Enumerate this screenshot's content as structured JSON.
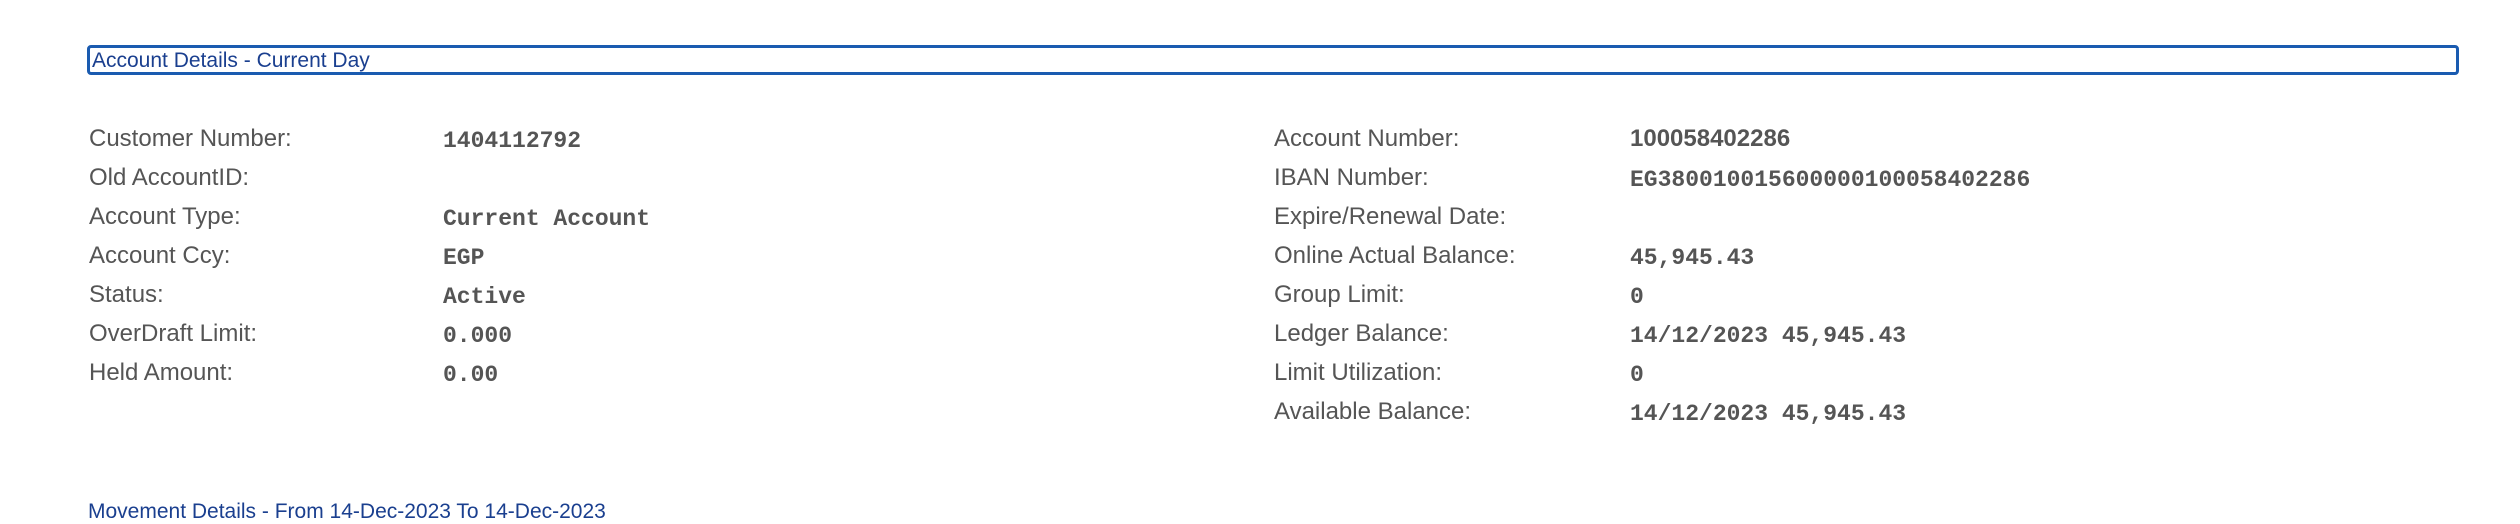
{
  "header": {
    "title": "Account Details - Current Day"
  },
  "left": {
    "rows": [
      {
        "label": "Customer Number:",
        "value": "1404112792"
      },
      {
        "label": "Old AccountID:",
        "value": ""
      },
      {
        "label": "Account Type:",
        "value": "Current Account"
      },
      {
        "label": "Account Ccy:",
        "value": "EGP"
      },
      {
        "label": "Status:",
        "value": "Active"
      },
      {
        "label": "OverDraft Limit:",
        "value": "0.000"
      },
      {
        "label": "Held Amount:",
        "value": "0.00"
      }
    ]
  },
  "right": {
    "rows": [
      {
        "label": "Account Number:",
        "value": "100058402286"
      },
      {
        "label": "IBAN Number:",
        "value": "EG380010015600000100058402286"
      },
      {
        "label": "Expire/Renewal Date:",
        "value": ""
      },
      {
        "label": "Online Actual Balance:",
        "value": "45,945.43"
      },
      {
        "label": "Group Limit:",
        "value": "0"
      },
      {
        "label": "Ledger Balance:",
        "value": "14/12/2023 45,945.43"
      },
      {
        "label": "Limit Utilization:",
        "value": "0"
      },
      {
        "label": "Available Balance:",
        "value": "14/12/2023 45,945.43"
      }
    ]
  },
  "movement": {
    "label": "Movement Details - From 14-Dec-2023 To 14-Dec-2023"
  },
  "colors": {
    "accent": "#1a5bb0",
    "link": "#1a3f8f",
    "text": "#555555"
  }
}
